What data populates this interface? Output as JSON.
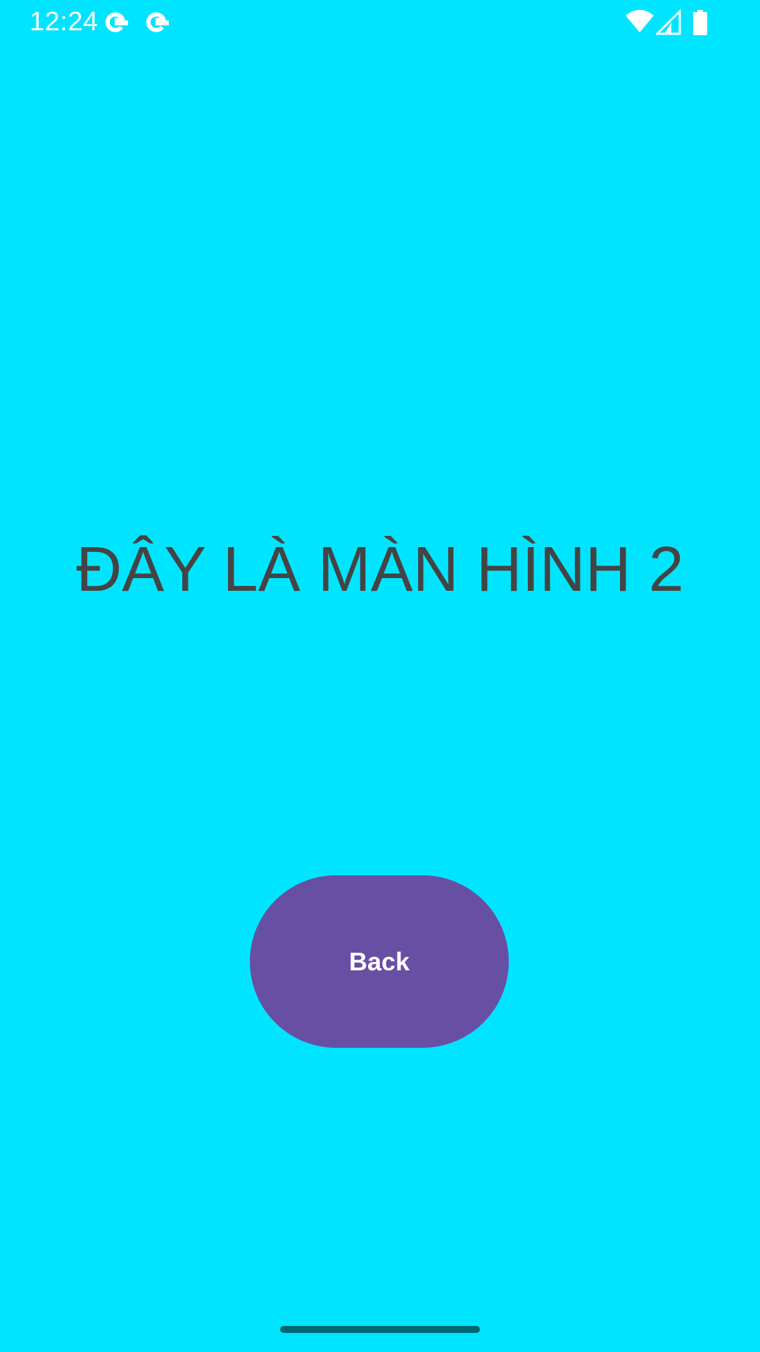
{
  "status_bar": {
    "time": "12:24",
    "notification_icons": [
      "google-icon",
      "google-icon"
    ],
    "system_icons": [
      "wifi-icon",
      "cellular-signal-icon",
      "battery-icon"
    ]
  },
  "main": {
    "title": "ĐÂY LÀ MÀN HÌNH 2",
    "back_button_label": "Back"
  },
  "colors": {
    "background": "#00E5FF",
    "title_text": "#444444",
    "button_background": "#6750A4",
    "button_text": "#FFFFFF",
    "status_icons": "#FFFFFF",
    "home_indicator": "#006874"
  }
}
